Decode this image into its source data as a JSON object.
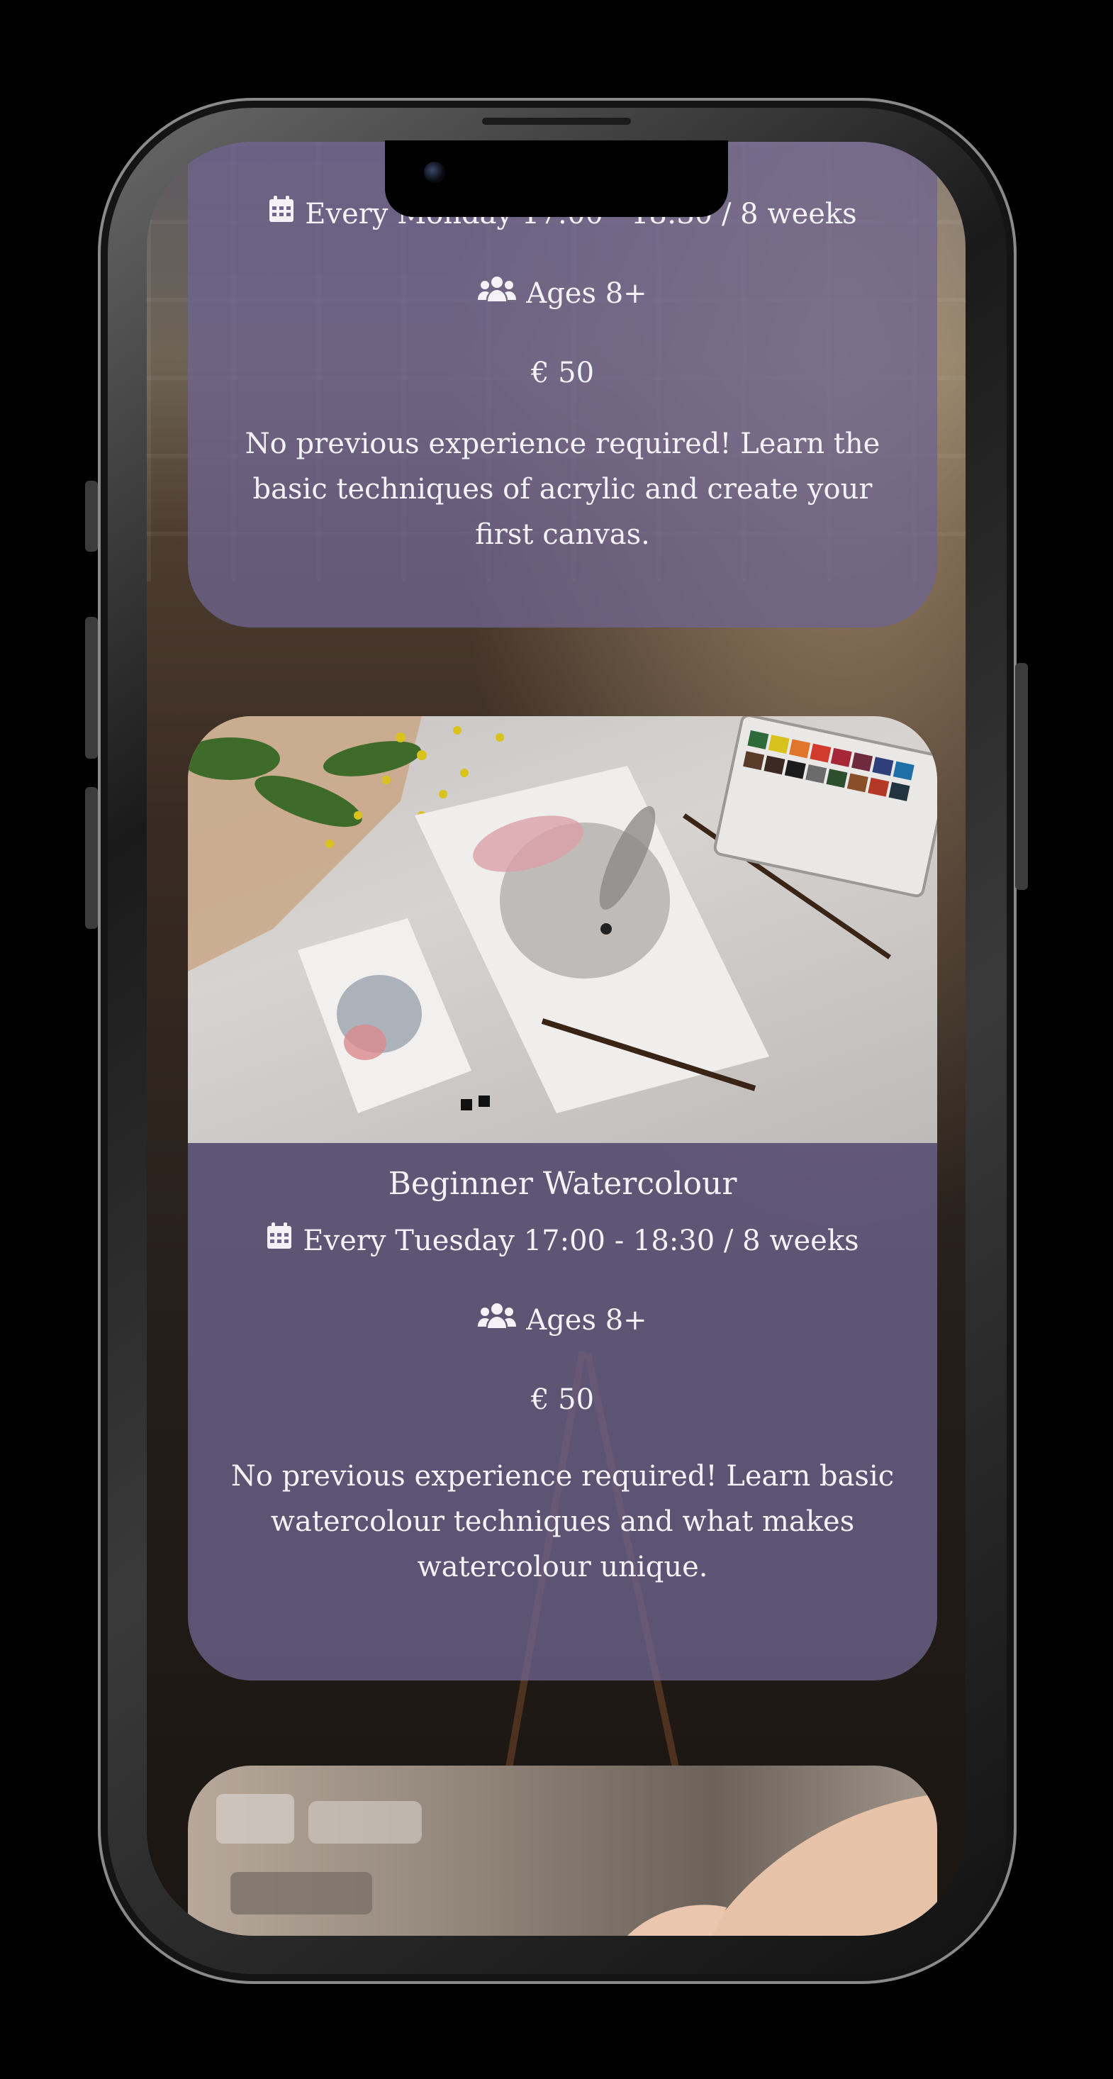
{
  "device": "phone-mockup",
  "classes": [
    {
      "id": "acrylic",
      "schedule": "Every Monday 17:00 - 18:30 / 8 weeks",
      "ages": "Ages 8+",
      "price": "€ 50",
      "description": "No previous experience required! Learn the basic techniques of acrylic and create your first canvas."
    },
    {
      "id": "watercolour",
      "title": "Beginner Watercolour",
      "schedule": "Every Tuesday 17:00 - 18:30 / 8 weeks",
      "ages": "Ages 8+",
      "price": "€ 50",
      "description": "No previous experience required! Learn basic watercolour techniques and what makes watercolour unique.",
      "image": "watercolour-rabbit-painting-photo"
    },
    {
      "id": "next",
      "image": "hand-painting-photo"
    }
  ],
  "icons": {
    "calendar": "calendar-icon",
    "users": "users-icon"
  },
  "colors": {
    "card": "#6e648e",
    "text": "#f4f1f7"
  }
}
